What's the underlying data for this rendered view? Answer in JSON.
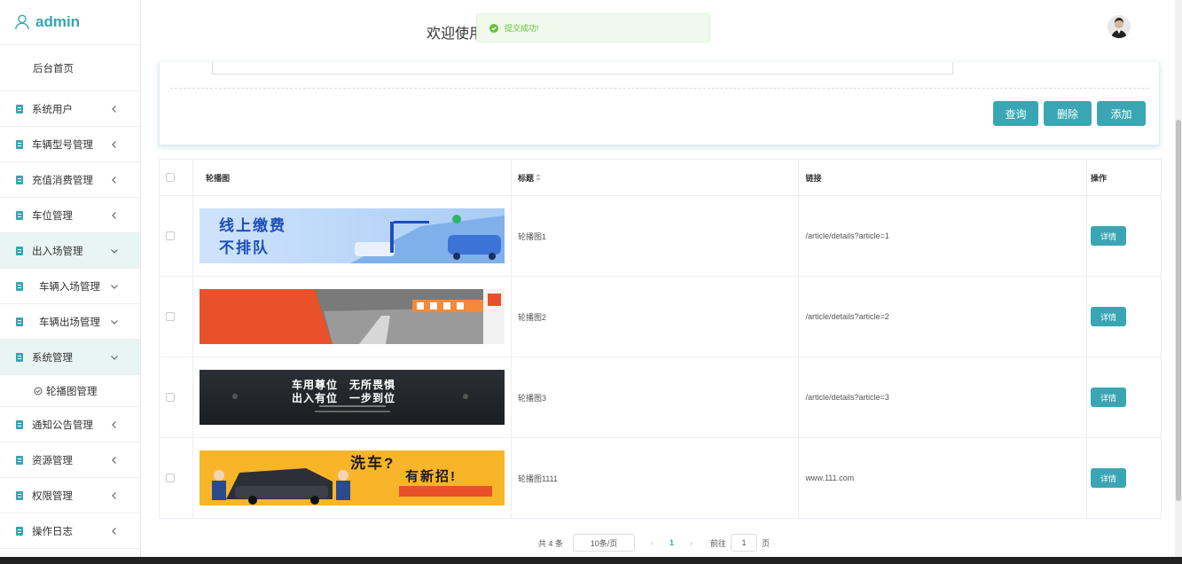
{
  "sidebar": {
    "brand": "admin",
    "home": "后台首页",
    "items": [
      {
        "label": "系统用户"
      },
      {
        "label": "车辆型号管理"
      },
      {
        "label": "充值消费管理"
      },
      {
        "label": "车位管理"
      },
      {
        "label": "出入场管理"
      },
      {
        "label": "车辆入场管理"
      },
      {
        "label": "车辆出场管理"
      },
      {
        "label": "系统管理"
      },
      {
        "label": "轮播图管理"
      },
      {
        "label": "通知公告管理"
      },
      {
        "label": "资源管理"
      },
      {
        "label": "权限管理"
      },
      {
        "label": "操作日志"
      }
    ]
  },
  "header": {
    "welcome": "欢迎使用",
    "toast": "提交成功!"
  },
  "toolbar": {
    "query": "查询",
    "delete": "删除",
    "add": "添加"
  },
  "table": {
    "columns": [
      "轮播图",
      "标题",
      "链接",
      "操作"
    ],
    "rows": [
      {
        "banner_text": [
          "线上缴费",
          "不排队"
        ],
        "title": "轮播图1",
        "link": "/article/details?article=1",
        "action": "详情"
      },
      {
        "banner_text": [],
        "title": "轮播图2",
        "link": "/article/details?article=2",
        "action": "详情"
      },
      {
        "banner_text": [
          "车用尊位　无所畏惧",
          "出入有位　一步到位"
        ],
        "title": "轮播图3",
        "link": "/article/details?article=3",
        "action": "详情"
      },
      {
        "banner_text": [
          "洗车?",
          "有新招!"
        ],
        "title": "轮播图1111",
        "link": "www.111.com",
        "action": "详情"
      }
    ]
  },
  "pagination": {
    "total": "共 4 条",
    "page_size": "10条/页",
    "current": "1",
    "goto_label": "前往",
    "goto_value": "1",
    "page_unit": "页",
    "prev": "‹",
    "next": "›"
  },
  "colors": {
    "accent": "#36a6b4",
    "active_bg": "#e9f5f2",
    "toast_text": "#67c23a"
  }
}
